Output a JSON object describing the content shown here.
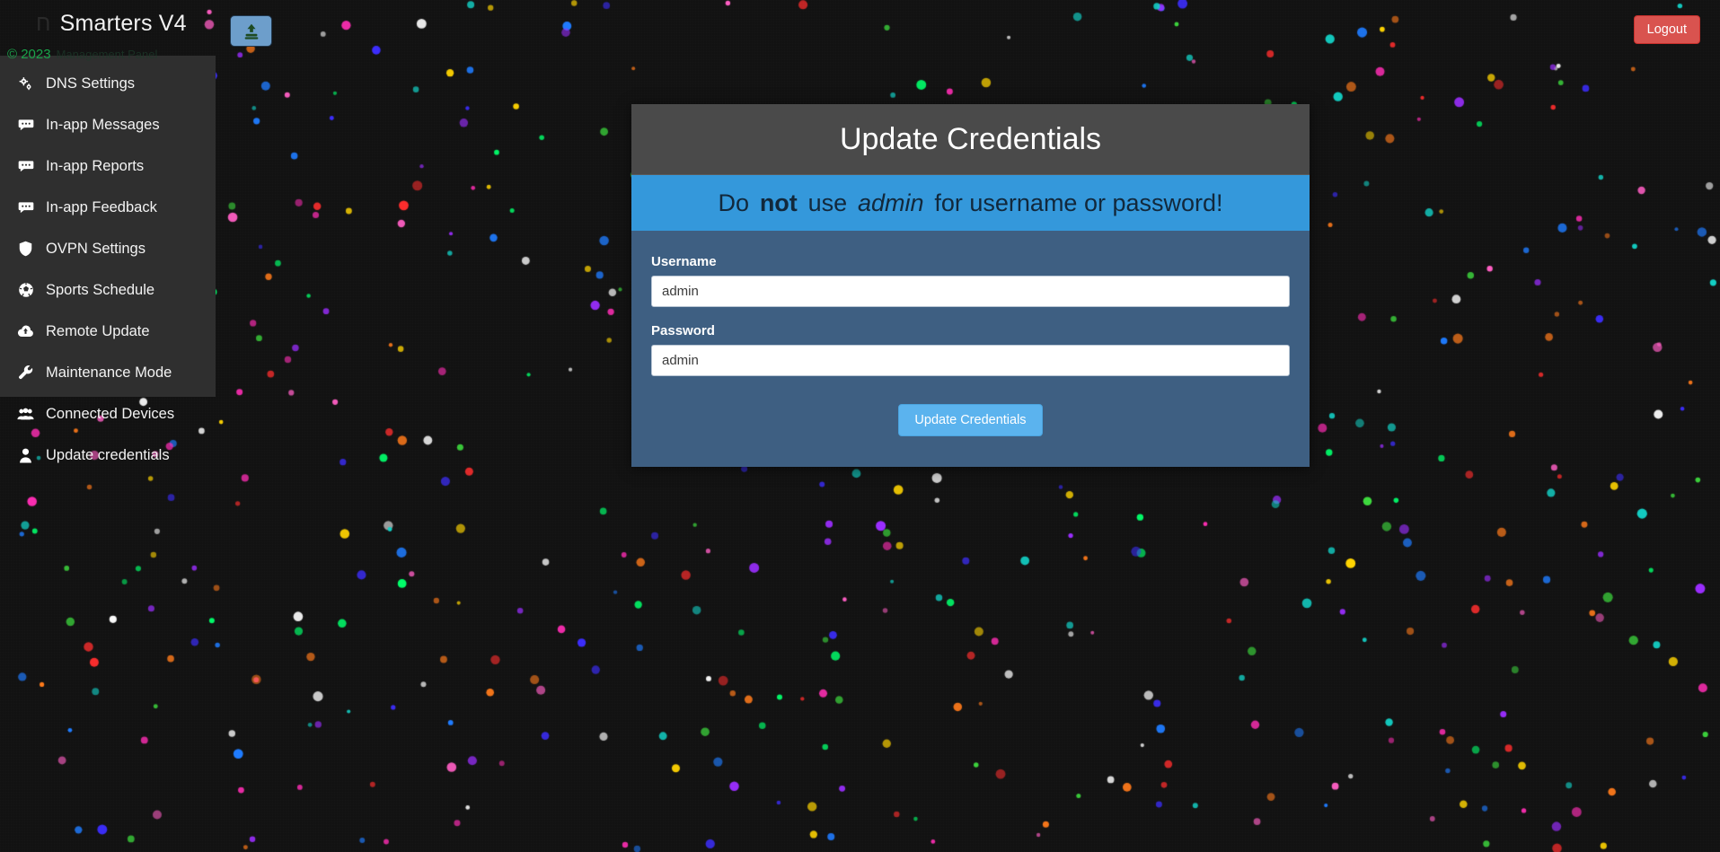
{
  "brand": {
    "title_dim": "ח",
    "title": "Smarters V4",
    "nav_toggle_icon": "upload-icon",
    "logout_label": "Logout"
  },
  "copyright": {
    "year": "© 2023",
    "note": "Management Panel"
  },
  "sidebar": {
    "items": [
      {
        "label": "DNS Settings",
        "icon": "cogs-icon"
      },
      {
        "label": "In-app Messages",
        "icon": "comment-icon"
      },
      {
        "label": "In-app Reports",
        "icon": "comment-icon"
      },
      {
        "label": "In-app Feedback",
        "icon": "comment-icon"
      },
      {
        "label": "OVPN Settings",
        "icon": "shield-icon"
      },
      {
        "label": "Sports Schedule",
        "icon": "soccer-ball-icon"
      },
      {
        "label": "Remote Update",
        "icon": "cloud-upload-icon"
      },
      {
        "label": "Maintenance Mode",
        "icon": "wrench-icon"
      },
      {
        "label": "Connected Devices",
        "icon": "users-icon"
      },
      {
        "label": "Update credentials",
        "icon": "user-icon"
      }
    ]
  },
  "card": {
    "title": "Update Credentials",
    "alert": {
      "part1": "Do",
      "bold": "not",
      "part2": "use",
      "italic": "admin",
      "part3": "for username or password!"
    },
    "username": {
      "label": "Username",
      "value": "admin",
      "placeholder": "Username"
    },
    "password": {
      "label": "Password",
      "value": "admin",
      "placeholder": "Password"
    },
    "submit_label": "Update Credentials"
  },
  "colors": {
    "accent_blue": "#3498db",
    "card_body": "#3e5f82",
    "card_head": "#4a4a4a",
    "sidebar": "#2f2f2f",
    "logout_red": "#d9534f",
    "submit_blue": "#5bb3ee",
    "copyright_green": "#1aa34a",
    "page_bg": "#121212"
  }
}
